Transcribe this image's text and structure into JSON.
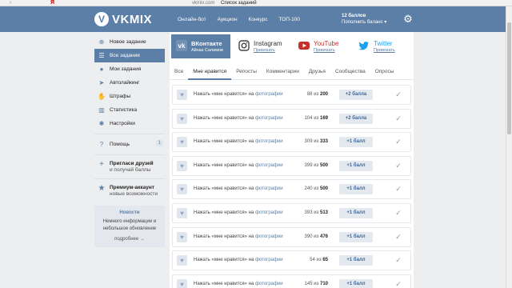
{
  "browser": {
    "back_glyph": "‹",
    "yandex_glyph": "Я",
    "site": "vkmix.com",
    "page_title": "Список заданий"
  },
  "header": {
    "logo_mark": "V",
    "logo_text": "VKMIX",
    "nav": [
      "Онлайн-бот",
      "Аукцион",
      "Конкурс",
      "ТОП-100"
    ],
    "balance": "12 баллов",
    "balance_action": "Пополнить баланс ▾",
    "settings_icon": "gear-icon"
  },
  "colors": {
    "brand": "#5b7fa6",
    "youtube": "#c4302b",
    "twitter": "#1da1f2"
  },
  "sidebar": {
    "items": [
      {
        "label": "Новое задание",
        "icon": "plus-circle-icon",
        "glyph": "⊕"
      },
      {
        "label": "Все задания",
        "icon": "list-icon",
        "glyph": "☰"
      },
      {
        "label": "Мои задания",
        "icon": "user-icon",
        "glyph": "●"
      },
      {
        "label": "Автолайкинг",
        "icon": "rocket-icon",
        "glyph": "➤"
      },
      {
        "label": "Штрафы",
        "icon": "hand-icon",
        "glyph": "✋"
      },
      {
        "label": "Статистика",
        "icon": "chart-icon",
        "glyph": "▥"
      },
      {
        "label": "Настройки",
        "icon": "settings-icon",
        "glyph": "✱"
      }
    ],
    "help": {
      "label": "Помощь",
      "badge": "1",
      "glyph": "?"
    },
    "invite": {
      "title": "Пригласи друзей",
      "subtitle": "и получай баллы",
      "glyph": "+"
    },
    "premium": {
      "title": "Премиум-аккаунт",
      "subtitle": "новые возможности",
      "glyph": "★"
    },
    "news": {
      "title": "Новости",
      "text": "Немного информации и небольшое обновление",
      "more": "подробнее →"
    }
  },
  "services": {
    "vk": {
      "name": "ВКонтакте",
      "sub": "Айназ Салимов"
    },
    "instagram": {
      "name": "Instagram",
      "sub": "Привязать"
    },
    "youtube": {
      "name": "YouTube",
      "sub": "Привязать"
    },
    "twitter": {
      "name": "Twitter",
      "sub": "Привязать"
    }
  },
  "tabs": [
    "Все",
    "Мне нравится",
    "Репосты",
    "Комментарии",
    "Друзья",
    "Сообщества",
    "Опросы"
  ],
  "tasks": [
    {
      "text": "Нажать «мне нравится» на",
      "link": "фотографии",
      "done": "88",
      "of": "из",
      "total": "200",
      "reward": "+2 балла"
    },
    {
      "text": "Нажать «мне нравится» на",
      "link": "фотографии",
      "done": "104",
      "of": "из",
      "total": "169",
      "reward": "+2 балла"
    },
    {
      "text": "Нажать «мне нравится» на",
      "link": "фотографии",
      "done": "309",
      "of": "из",
      "total": "333",
      "reward": "+1 балл"
    },
    {
      "text": "Нажать «мне нравится» на",
      "link": "фотографии",
      "done": "399",
      "of": "из",
      "total": "500",
      "reward": "+1 балл"
    },
    {
      "text": "Нажать «мне нравится» на",
      "link": "фотографии",
      "done": "240",
      "of": "из",
      "total": "500",
      "reward": "+1 балл"
    },
    {
      "text": "Нажать «мне нравится» на",
      "link": "фотографии",
      "done": "393",
      "of": "из",
      "total": "513",
      "reward": "+1 балл"
    },
    {
      "text": "Нажать «мне нравится» на",
      "link": "фотографии",
      "done": "390",
      "of": "из",
      "total": "476",
      "reward": "+1 балл"
    },
    {
      "text": "Нажать «мне нравится» на",
      "link": "фотографии",
      "done": "54",
      "of": "из",
      "total": "65",
      "reward": "+1 балл"
    },
    {
      "text": "Нажать «мне нравится» на",
      "link": "фотографии",
      "done": "145",
      "of": "из",
      "total": "710",
      "reward": "+1 балл"
    }
  ],
  "glyphs": {
    "heart": "♥",
    "check": "✓"
  }
}
